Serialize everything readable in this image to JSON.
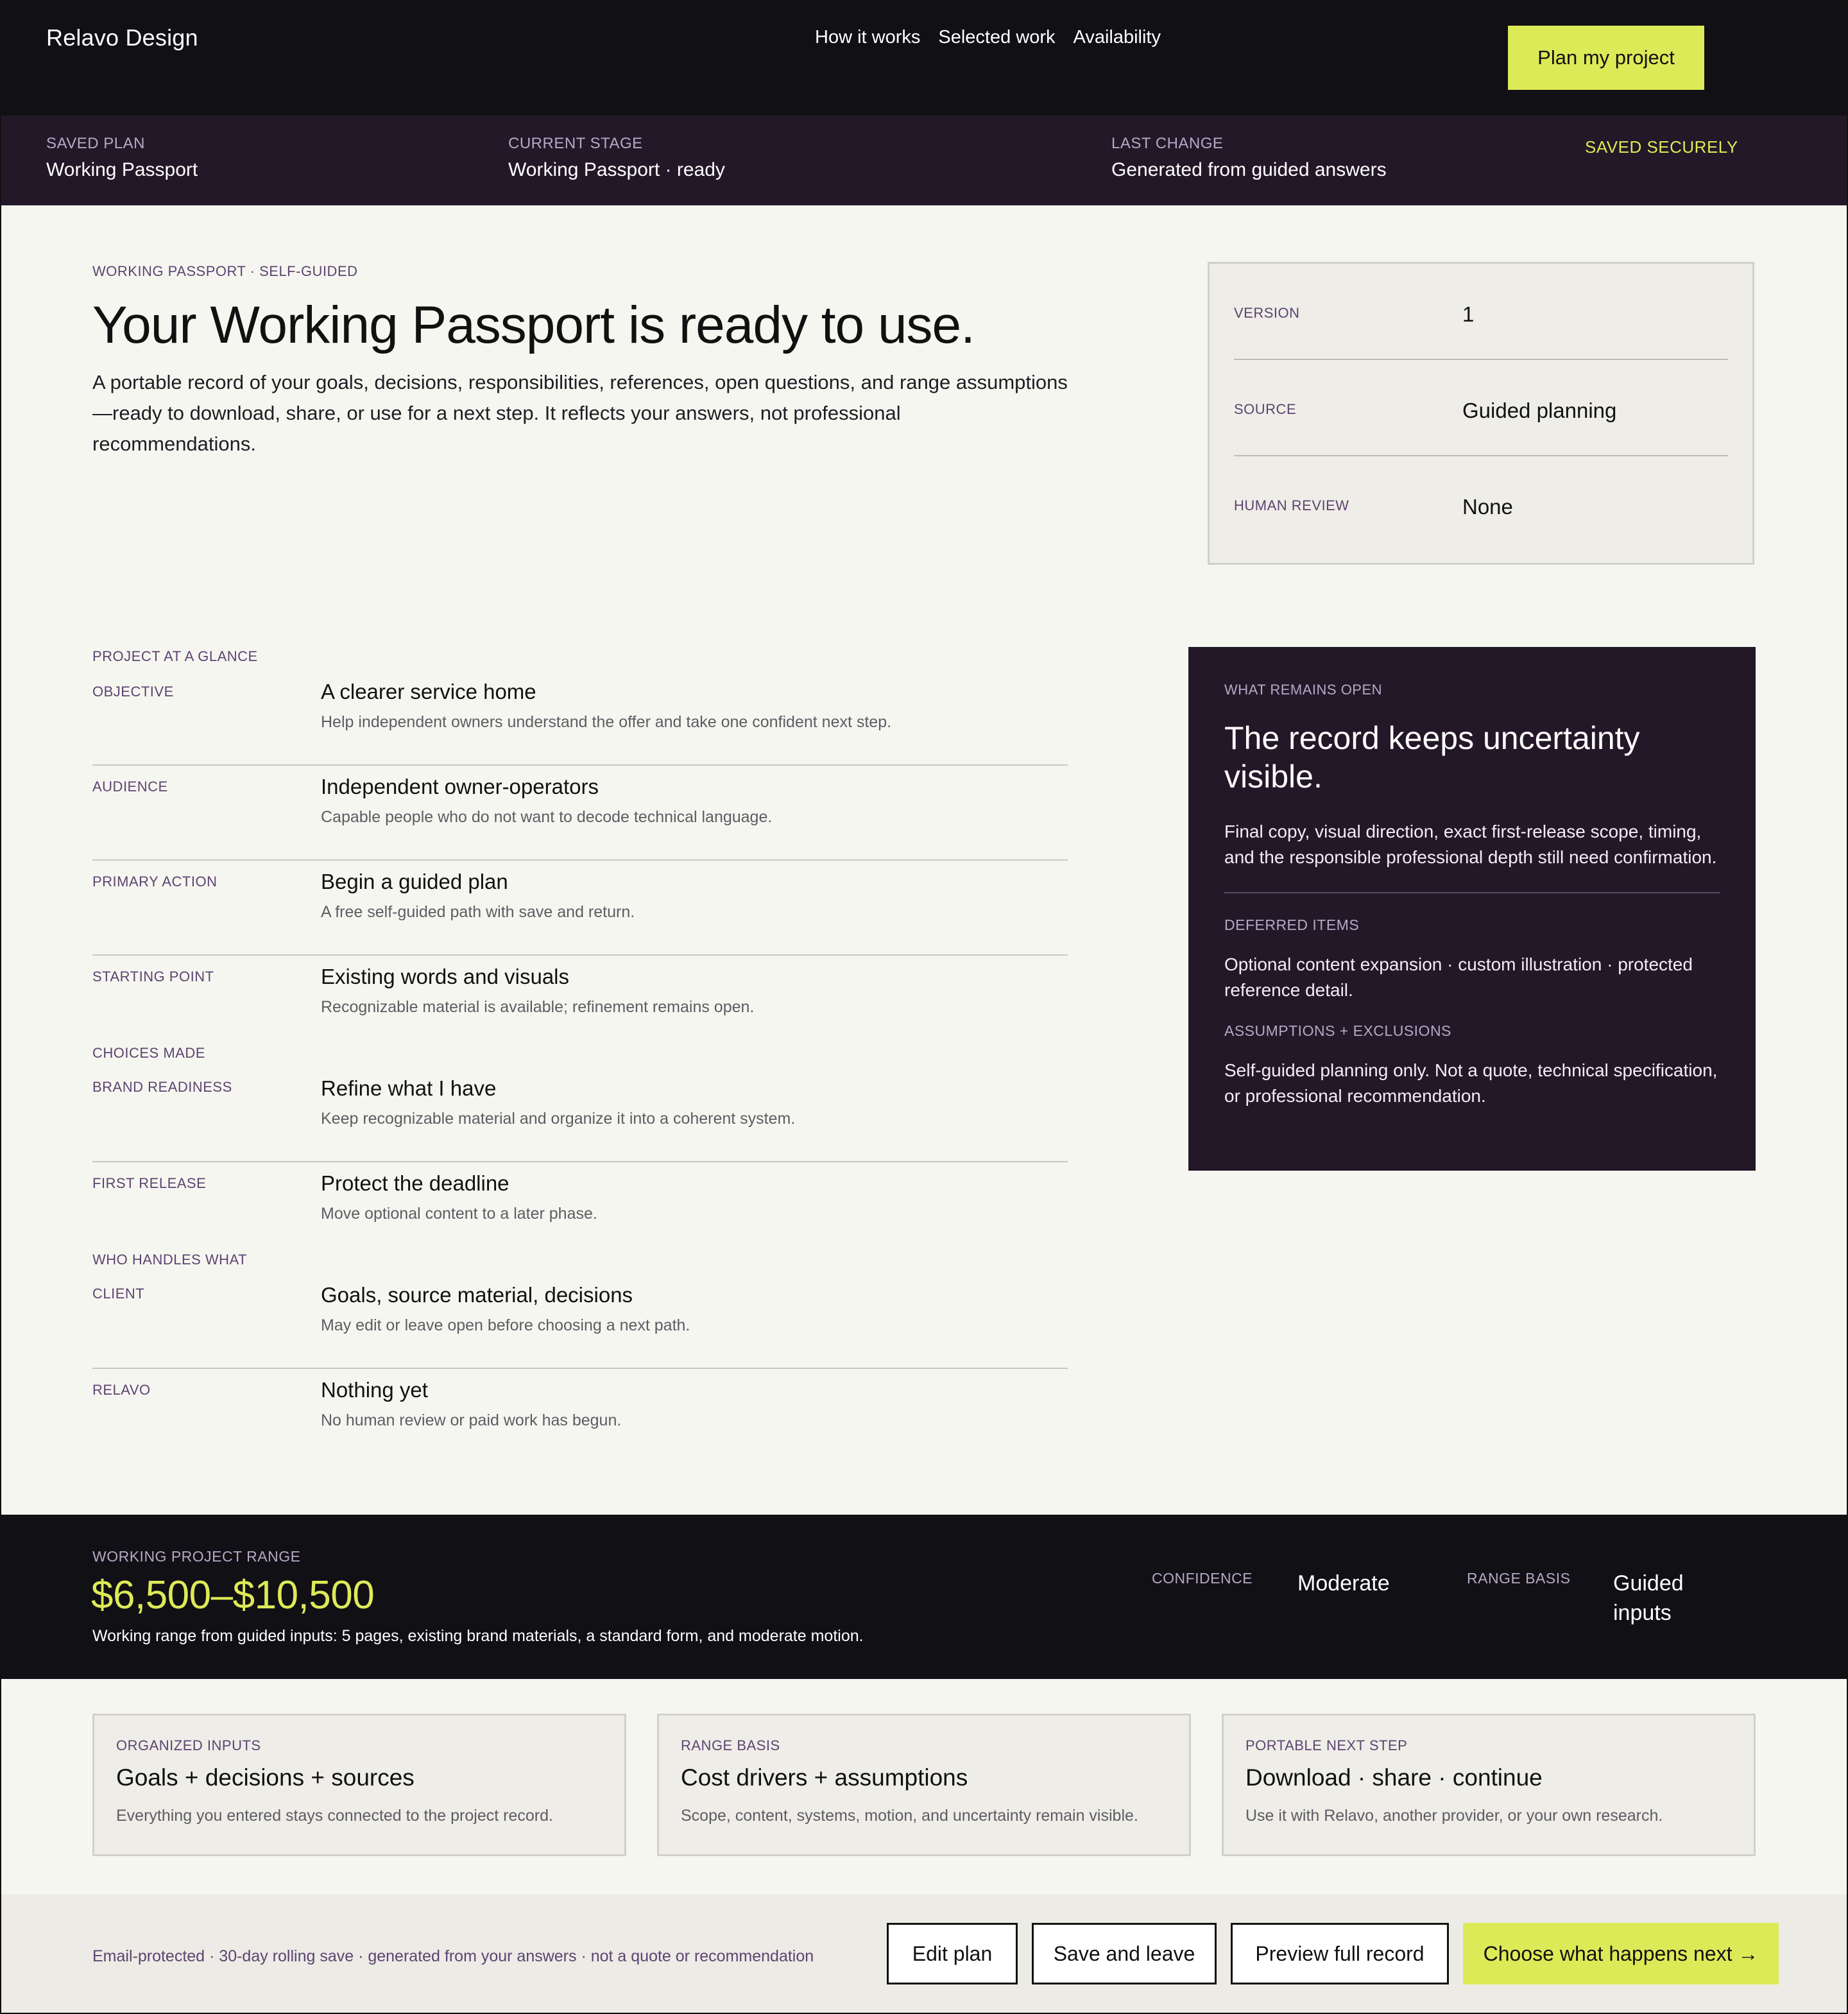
{
  "header": {
    "brand": "Relavo Design",
    "nav": [
      "How it works",
      "Selected work",
      "Availability"
    ],
    "cta": "Plan my project"
  },
  "status": {
    "items": [
      {
        "label": "SAVED PLAN",
        "value": "Working Passport"
      },
      {
        "label": "CURRENT STAGE",
        "value": "Working Passport · ready"
      },
      {
        "label": "LAST CHANGE",
        "value": "Generated from guided answers"
      }
    ],
    "badge": "SAVED SECURELY"
  },
  "intro": {
    "eyebrow": "WORKING PASSPORT · SELF-GUIDED",
    "title": "Your Working Passport is ready to use.",
    "body": "A portable record of your goals, decisions, responsibilities, references, open questions, and range assumptions—ready to download, share, or use for a next step. It reflects your answers, not professional recommendations."
  },
  "meta": [
    {
      "label": "VERSION",
      "value": "1"
    },
    {
      "label": "SOURCE",
      "value": "Guided planning"
    },
    {
      "label": "HUMAN REVIEW",
      "value": "None"
    }
  ],
  "glance": {
    "label": "PROJECT AT A GLANCE",
    "rows": [
      {
        "label": "OBJECTIVE",
        "title": "A clearer service home",
        "sub": "Help independent owners understand the offer and take one confident next step."
      },
      {
        "label": "AUDIENCE",
        "title": "Independent owner-operators",
        "sub": "Capable people who do not want to decode technical language."
      },
      {
        "label": "PRIMARY ACTION",
        "title": "Begin a guided plan",
        "sub": "A free self-guided path with save and return."
      },
      {
        "label": "STARTING POINT",
        "title": "Existing words and visuals",
        "sub": "Recognizable material is available; refinement remains open."
      }
    ],
    "choices_label": "CHOICES MADE",
    "choices": [
      {
        "label": "BRAND READINESS",
        "title": "Refine what I have",
        "sub": "Keep recognizable material and organize it into a coherent system."
      },
      {
        "label": "FIRST RELEASE",
        "title": "Protect the deadline",
        "sub": "Move optional content to a later phase."
      }
    ],
    "handles_label": "WHO HANDLES WHAT",
    "handles": [
      {
        "label": "CLIENT",
        "title": "Goals, source material, decisions",
        "sub": "May edit or leave open before choosing a next path."
      },
      {
        "label": "RELAVO",
        "title": "Nothing yet",
        "sub": "No human review or paid work has begun."
      }
    ]
  },
  "open_panel": {
    "eyebrow": "WHAT REMAINS OPEN",
    "title": "The record keeps uncertainty visible.",
    "body": "Final copy, visual direction, exact first-release scope, timing, and the responsible professional depth still need confirmation.",
    "deferred_label": "DEFERRED ITEMS",
    "deferred": "Optional content expansion · custom illustration · protected reference detail.",
    "assumptions_label": "ASSUMPTIONS + EXCLUSIONS",
    "assumptions": "Self-guided planning only. Not a quote, technical specification, or professional recommendation."
  },
  "range": {
    "label": "WORKING PROJECT RANGE",
    "value": "$6,500–$10,500",
    "note": "Working range from guided inputs: 5 pages, existing brand materials, a standard form, and moderate motion.",
    "confidence_label": "CONFIDENCE",
    "confidence": "Moderate",
    "basis_label": "RANGE BASIS",
    "basis": "Guided inputs"
  },
  "cards": [
    {
      "eyebrow": "ORGANIZED INPUTS",
      "title": "Goals + decisions + sources",
      "sub": "Everything you entered stays connected to the project record."
    },
    {
      "eyebrow": "RANGE BASIS",
      "title": "Cost drivers + assumptions",
      "sub": "Scope, content, systems, motion, and uncertainty remain visible."
    },
    {
      "eyebrow": "PORTABLE NEXT STEP",
      "title": "Download · share · continue",
      "sub": "Use it with Relavo, another provider, or your own research."
    }
  ],
  "footer": {
    "note": "Email-protected · 30-day rolling save · generated from your answers · not a quote or recommendation",
    "buttons": {
      "edit": "Edit plan",
      "save": "Save and leave",
      "preview": "Preview full record",
      "next": "Choose what happens next →"
    }
  },
  "colors": {
    "accent": "#ddea57",
    "dark": "#111015",
    "plum": "#231828",
    "label": "#5c4470",
    "page": "#f6f6f1"
  }
}
